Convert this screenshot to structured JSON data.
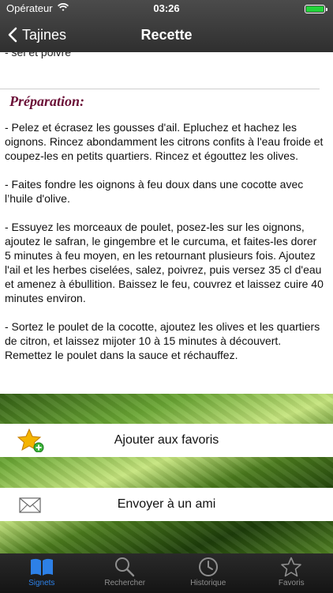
{
  "status": {
    "carrier": "Opérateur",
    "time": "03:26",
    "battery_level": 1.0
  },
  "nav": {
    "back_label": "Tajines",
    "title": "Recette"
  },
  "content": {
    "previous_line": "- sel et poivre",
    "section_title": "Préparation:",
    "paragraphs": [
      "- Pelez et écrasez les gousses d'ail. Epluchez et hachez les oignons. Rincez abondamment les citrons confits à l'eau froide et coupez-les en petits quartiers. Rincez et égouttez les olives.",
      "- Faites fondre les oignons à feu doux dans une cocotte avec l’huile d'olive.",
      "- Essuyez les morceaux de poulet, posez-les sur les oignons, ajoutez le safran, le gingembre et le curcuma, et faites-les dorer 5 minutes à feu moyen, en les retournant plusieurs fois. Ajoutez l'ail et les herbes ciselées, salez, poivrez, puis versez 35 cl d'eau et amenez à ébullition. Baissez le feu, couvrez et laissez cuire 40 minutes environ.",
      "- Sortez le poulet de la cocotte, ajoutez les olives et les quartiers de citron, et laissez mijoter 10 à 15 minutes à découvert. Remettez le poulet dans la sauce et réchauffez."
    ]
  },
  "actions": {
    "favorite_label": "Ajouter aux favoris",
    "favorite_icon": "star-plus-icon",
    "share_label": "Envoyer à un ami",
    "share_icon": "envelope-icon"
  },
  "tabs": [
    {
      "label": "Signets",
      "icon": "book-icon",
      "active": true
    },
    {
      "label": "Rechercher",
      "icon": "search-icon",
      "active": false
    },
    {
      "label": "Historique",
      "icon": "clock-icon",
      "active": false
    },
    {
      "label": "Favoris",
      "icon": "star-icon",
      "active": false
    }
  ],
  "colors": {
    "nav_bg": "#3a3a3a",
    "section_title": "#6b1037",
    "tab_active": "#2d80e6",
    "tab_inactive": "#8f8f8f",
    "battery": "#22d33a"
  }
}
